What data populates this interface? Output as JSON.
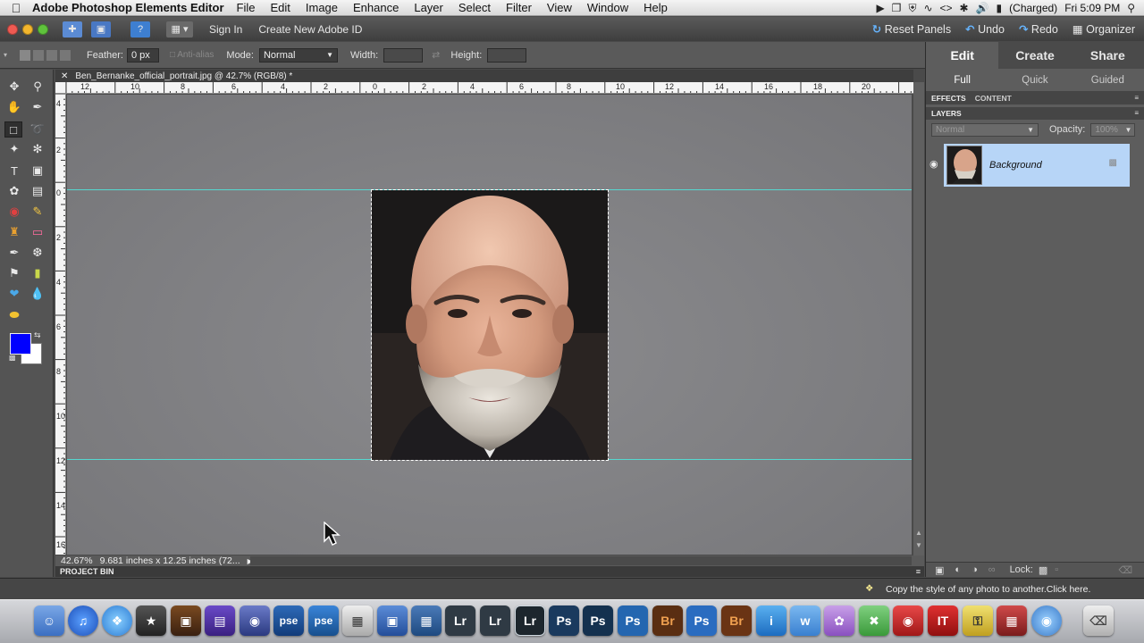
{
  "menubar": {
    "app_name": "Adobe Photoshop Elements Editor",
    "menus": [
      "File",
      "Edit",
      "Image",
      "Enhance",
      "Layer",
      "Select",
      "Filter",
      "View",
      "Window",
      "Help"
    ],
    "battery": "(Charged)",
    "clock": "Fri 5:09 PM"
  },
  "appbar": {
    "sign_in": "Sign In",
    "create_id": "Create New Adobe ID",
    "reset_panels": "Reset Panels",
    "undo": "Undo",
    "redo": "Redo",
    "organizer": "Organizer"
  },
  "options": {
    "feather_label": "Feather:",
    "feather_value": "0 px",
    "anti_alias": "Anti-alias",
    "mode_label": "Mode:",
    "mode_value": "Normal",
    "width_label": "Width:",
    "height_label": "Height:"
  },
  "document": {
    "tab_title": "Ben_Bernanke_official_portrait.jpg @ 42.7% (RGB/8) *",
    "zoom": "42.67%",
    "dimensions": "9.681 inches x 12.25 inches (72...",
    "h_ruler": [
      "12",
      "10",
      "8",
      "6",
      "4",
      "2",
      "0",
      "2",
      "4",
      "6",
      "8",
      "10",
      "12",
      "14",
      "16",
      "18",
      "20"
    ],
    "v_ruler": [
      "4",
      "2",
      "0",
      "2",
      "4",
      "6",
      "8",
      "10",
      "12",
      "14",
      "16"
    ],
    "project_bin": "PROJECT BIN"
  },
  "panel": {
    "mode_tabs": [
      "Edit",
      "Create",
      "Share"
    ],
    "sub_tabs": [
      "Full",
      "Quick",
      "Guided"
    ],
    "effects_tab": "EFFECTS",
    "content_tab": "CONTENT",
    "layers_header": "LAYERS",
    "blend_mode": "Normal",
    "opacity_label": "Opacity:",
    "opacity_value": "100%",
    "layer_name": "Background",
    "lock_label": "Lock:"
  },
  "tip": {
    "text": "Copy the style of any photo to another.Click here."
  },
  "dock": {
    "labels": [
      "pse",
      "pse",
      "Lr",
      "Lr",
      "Lr",
      "Ps",
      "Ps",
      "Ps",
      "Br",
      "Ps",
      "Br",
      "i",
      "IT"
    ]
  },
  "colors": {
    "foreground": "#0000ff",
    "background": "#ffffff",
    "guide": "#55d8d0",
    "accent": "#66b5ff"
  }
}
